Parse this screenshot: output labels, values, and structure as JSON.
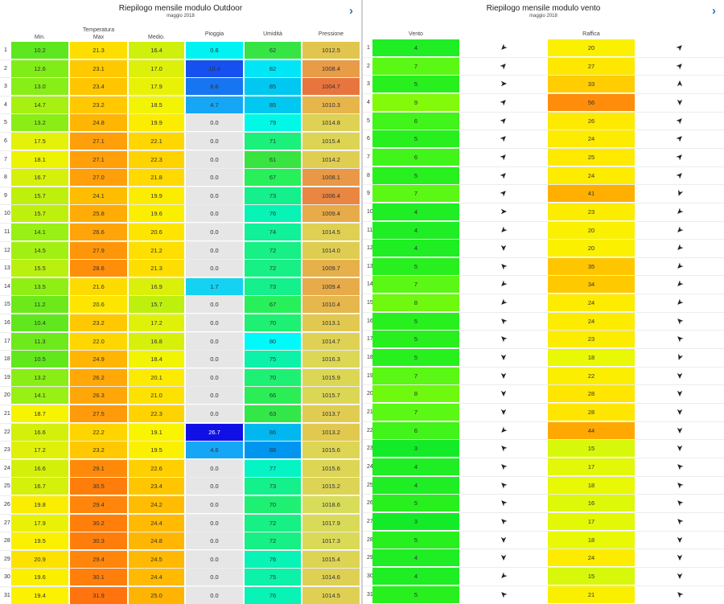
{
  "left": {
    "title": "Riepilogo mensile modulo Outdoor",
    "subtitle": "maggio 2018",
    "nav_next": "›",
    "headers": {
      "min": "Min.",
      "tmax_line1": "Temperatura",
      "tmax_line2": "Max",
      "medio": "Medio.",
      "pioggia": "Pioggia",
      "umidita": "Umidità",
      "pressione": "Pressione"
    },
    "rows": [
      {
        "day": "1",
        "min": "10.2",
        "max": "21.3",
        "med": "16.4",
        "rain": "0.6",
        "hum": "62",
        "press": "1012.5"
      },
      {
        "day": "2",
        "min": "12.6",
        "max": "23.1",
        "med": "17.0",
        "rain": "10.4",
        "hum": "82",
        "press": "1008.4"
      },
      {
        "day": "3",
        "min": "13.0",
        "max": "23.4",
        "med": "17.9",
        "rain": "8.6",
        "hum": "85",
        "press": "1004.7"
      },
      {
        "day": "4",
        "min": "14.7",
        "max": "23.2",
        "med": "18.5",
        "rain": "4.7",
        "hum": "85",
        "press": "1010.3"
      },
      {
        "day": "5",
        "min": "13.2",
        "max": "24.8",
        "med": "19.9",
        "rain": "0.0",
        "hum": "79",
        "press": "1014.8"
      },
      {
        "day": "6",
        "min": "17.5",
        "max": "27.1",
        "med": "22.1",
        "rain": "0.0",
        "hum": "71",
        "press": "1015.4"
      },
      {
        "day": "7",
        "min": "18.1",
        "max": "27.1",
        "med": "22.3",
        "rain": "0.0",
        "hum": "61",
        "press": "1014.2"
      },
      {
        "day": "8",
        "min": "16.7",
        "max": "27.0",
        "med": "21.8",
        "rain": "0.0",
        "hum": "67",
        "press": "1008.1"
      },
      {
        "day": "9",
        "min": "15.7",
        "max": "24.1",
        "med": "19.9",
        "rain": "0.0",
        "hum": "73",
        "press": "1006.4"
      },
      {
        "day": "10",
        "min": "15.7",
        "max": "25.8",
        "med": "19.6",
        "rain": "0.0",
        "hum": "76",
        "press": "1009.4"
      },
      {
        "day": "11",
        "min": "14.1",
        "max": "26.6",
        "med": "20.6",
        "rain": "0.0",
        "hum": "74",
        "press": "1014.5"
      },
      {
        "day": "12",
        "min": "14.5",
        "max": "27.9",
        "med": "21.2",
        "rain": "0.0",
        "hum": "72",
        "press": "1014.0"
      },
      {
        "day": "13",
        "min": "15.5",
        "max": "28.6",
        "med": "21.3",
        "rain": "0.0",
        "hum": "72",
        "press": "1009.7"
      },
      {
        "day": "14",
        "min": "13.5",
        "max": "21.6",
        "med": "16.9",
        "rain": "1.7",
        "hum": "73",
        "press": "1009.4"
      },
      {
        "day": "15",
        "min": "11.2",
        "max": "20.6",
        "med": "15.7",
        "rain": "0.0",
        "hum": "67",
        "press": "1010.4"
      },
      {
        "day": "16",
        "min": "10.4",
        "max": "23.2",
        "med": "17.2",
        "rain": "0.0",
        "hum": "70",
        "press": "1013.1"
      },
      {
        "day": "17",
        "min": "11.3",
        "max": "22.0",
        "med": "16.8",
        "rain": "0.0",
        "hum": "80",
        "press": "1014.7"
      },
      {
        "day": "18",
        "min": "10.5",
        "max": "24.9",
        "med": "18.4",
        "rain": "0.0",
        "hum": "75",
        "press": "1016.3"
      },
      {
        "day": "19",
        "min": "13.2",
        "max": "26.2",
        "med": "20.1",
        "rain": "0.0",
        "hum": "70",
        "press": "1015.9"
      },
      {
        "day": "20",
        "min": "14.1",
        "max": "26.3",
        "med": "21.0",
        "rain": "0.0",
        "hum": "66",
        "press": "1015.7"
      },
      {
        "day": "21",
        "min": "18.7",
        "max": "27.5",
        "med": "22.3",
        "rain": "0.0",
        "hum": "63",
        "press": "1013.7"
      },
      {
        "day": "22",
        "min": "16.6",
        "max": "22.2",
        "med": "19.1",
        "rain": "26.7",
        "hum": "86",
        "press": "1013.2"
      },
      {
        "day": "23",
        "min": "17.2",
        "max": "23.2",
        "med": "19.5",
        "rain": "4.6",
        "hum": "88",
        "press": "1015.6"
      },
      {
        "day": "24",
        "min": "16.6",
        "max": "29.1",
        "med": "22.6",
        "rain": "0.0",
        "hum": "77",
        "press": "1015.6"
      },
      {
        "day": "25",
        "min": "16.7",
        "max": "30.5",
        "med": "23.4",
        "rain": "0.0",
        "hum": "73",
        "press": "1015.2"
      },
      {
        "day": "26",
        "min": "19.8",
        "max": "29.4",
        "med": "24.2",
        "rain": "0.0",
        "hum": "70",
        "press": "1018.6"
      },
      {
        "day": "27",
        "min": "17.9",
        "max": "30.2",
        "med": "24.4",
        "rain": "0.0",
        "hum": "72",
        "press": "1017.9"
      },
      {
        "day": "28",
        "min": "19.5",
        "max": "30.3",
        "med": "24.8",
        "rain": "0.0",
        "hum": "72",
        "press": "1017.3"
      },
      {
        "day": "29",
        "min": "20.9",
        "max": "29.4",
        "med": "24.5",
        "rain": "0.0",
        "hum": "76",
        "press": "1015.4"
      },
      {
        "day": "30",
        "min": "19.6",
        "max": "30.1",
        "med": "24.4",
        "rain": "0.0",
        "hum": "75",
        "press": "1014.6"
      },
      {
        "day": "31",
        "min": "19.4",
        "max": "31.9",
        "med": "25.0",
        "rain": "0.0",
        "hum": "76",
        "press": "1014.5"
      }
    ]
  },
  "right": {
    "title": "Riepilogo mensile modulo vento",
    "subtitle": "maggio 2018",
    "nav_next": "›",
    "headers": {
      "vento": "Vento",
      "raffica": "Raffica"
    },
    "rows": [
      {
        "day": "1",
        "wind": "4",
        "wdir": 225,
        "gust": "20",
        "gdir": 45
      },
      {
        "day": "2",
        "wind": "7",
        "wdir": 45,
        "gust": "27",
        "gdir": 45
      },
      {
        "day": "3",
        "wind": "5",
        "wdir": 90,
        "gust": "33",
        "gdir": 0
      },
      {
        "day": "4",
        "wind": "9",
        "wdir": 45,
        "gust": "56",
        "gdir": 180
      },
      {
        "day": "5",
        "wind": "6",
        "wdir": 45,
        "gust": "26",
        "gdir": 45
      },
      {
        "day": "6",
        "wind": "5",
        "wdir": 45,
        "gust": "24",
        "gdir": 45
      },
      {
        "day": "7",
        "wind": "6",
        "wdir": 45,
        "gust": "25",
        "gdir": 45
      },
      {
        "day": "8",
        "wind": "5",
        "wdir": 45,
        "gust": "24",
        "gdir": 45
      },
      {
        "day": "9",
        "wind": "7",
        "wdir": 45,
        "gust": "41",
        "gdir": 200
      },
      {
        "day": "10",
        "wind": "4",
        "wdir": 90,
        "gust": "23",
        "gdir": 225
      },
      {
        "day": "11",
        "wind": "4",
        "wdir": 225,
        "gust": "20",
        "gdir": 225
      },
      {
        "day": "12",
        "wind": "4",
        "wdir": 180,
        "gust": "20",
        "gdir": 225
      },
      {
        "day": "13",
        "wind": "5",
        "wdir": 315,
        "gust": "35",
        "gdir": 225
      },
      {
        "day": "14",
        "wind": "7",
        "wdir": 225,
        "gust": "34",
        "gdir": 225
      },
      {
        "day": "15",
        "wind": "8",
        "wdir": 225,
        "gust": "24",
        "gdir": 225
      },
      {
        "day": "16",
        "wind": "5",
        "wdir": 315,
        "gust": "24",
        "gdir": 315
      },
      {
        "day": "17",
        "wind": "5",
        "wdir": 315,
        "gust": "23",
        "gdir": 315
      },
      {
        "day": "18",
        "wind": "5",
        "wdir": 180,
        "gust": "18",
        "gdir": 200
      },
      {
        "day": "19",
        "wind": "7",
        "wdir": 180,
        "gust": "22",
        "gdir": 180
      },
      {
        "day": "20",
        "wind": "8",
        "wdir": 180,
        "gust": "28",
        "gdir": 180
      },
      {
        "day": "21",
        "wind": "7",
        "wdir": 180,
        "gust": "28",
        "gdir": 180
      },
      {
        "day": "22",
        "wind": "6",
        "wdir": 225,
        "gust": "44",
        "gdir": 180
      },
      {
        "day": "23",
        "wind": "3",
        "wdir": 315,
        "gust": "15",
        "gdir": 180
      },
      {
        "day": "24",
        "wind": "4",
        "wdir": 315,
        "gust": "17",
        "gdir": 315
      },
      {
        "day": "25",
        "wind": "4",
        "wdir": 315,
        "gust": "18",
        "gdir": 315
      },
      {
        "day": "26",
        "wind": "5",
        "wdir": 315,
        "gust": "16",
        "gdir": 315
      },
      {
        "day": "27",
        "wind": "3",
        "wdir": 315,
        "gust": "17",
        "gdir": 315
      },
      {
        "day": "28",
        "wind": "5",
        "wdir": 180,
        "gust": "18",
        "gdir": 180
      },
      {
        "day": "29",
        "wind": "4",
        "wdir": 180,
        "gust": "24",
        "gdir": 180
      },
      {
        "day": "30",
        "wind": "4",
        "wdir": 225,
        "gust": "15",
        "gdir": 180
      },
      {
        "day": "31",
        "wind": "5",
        "wdir": 315,
        "gust": "21",
        "gdir": 315
      }
    ]
  },
  "colors": {
    "accent": "#2b78c5",
    "divider": "#d0d0d0",
    "rain_zero": "#e6e6e6"
  }
}
